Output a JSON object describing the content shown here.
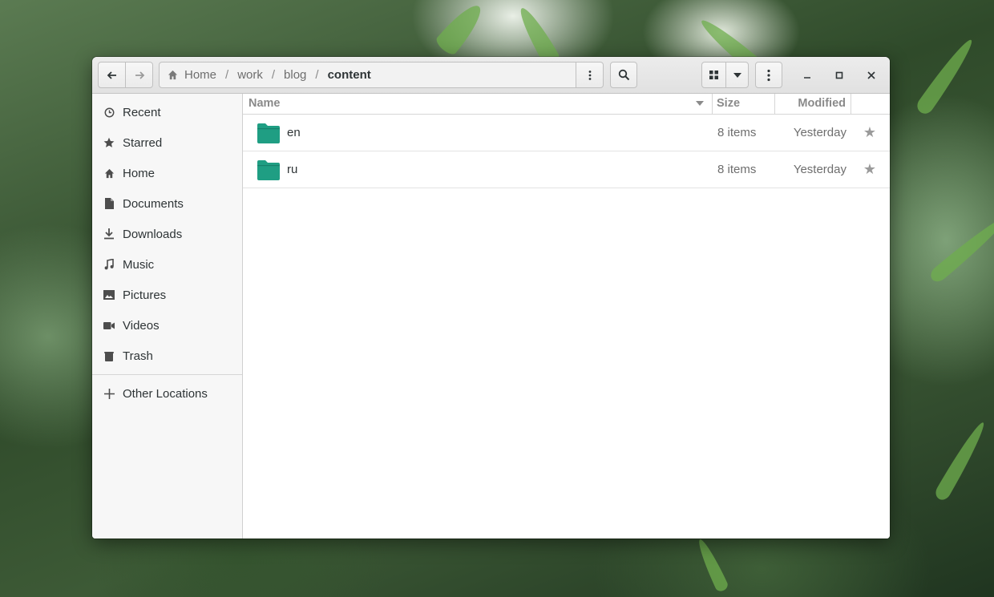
{
  "window": {
    "nav": {
      "back_icon": "arrow-left-icon",
      "forward_icon": "arrow-right-icon"
    },
    "path": [
      {
        "label": "Home",
        "icon": "home-icon"
      },
      {
        "label": "work"
      },
      {
        "label": "blog"
      },
      {
        "label": "content",
        "current": true
      }
    ],
    "path_separator": "/"
  },
  "sidebar": {
    "items": [
      {
        "label": "Recent",
        "icon": "clock-icon"
      },
      {
        "label": "Starred",
        "icon": "star-icon"
      },
      {
        "label": "Home",
        "icon": "home-icon"
      },
      {
        "label": "Documents",
        "icon": "document-icon"
      },
      {
        "label": "Downloads",
        "icon": "download-icon"
      },
      {
        "label": "Music",
        "icon": "music-note-icon"
      },
      {
        "label": "Pictures",
        "icon": "image-icon"
      },
      {
        "label": "Videos",
        "icon": "video-camera-icon"
      },
      {
        "label": "Trash",
        "icon": "trash-icon"
      }
    ],
    "other_locations": {
      "label": "Other Locations",
      "icon": "plus-icon"
    }
  },
  "columns": {
    "name": "Name",
    "size": "Size",
    "modified": "Modified"
  },
  "files": [
    {
      "name": "en",
      "size": "8 items",
      "modified": "Yesterday",
      "icon": "folder-icon"
    },
    {
      "name": "ru",
      "size": "8 items",
      "modified": "Yesterday",
      "icon": "folder-icon"
    }
  ],
  "colors": {
    "folder": "#1f9e83",
    "headerbar": "#e4e4e4",
    "sidebar": "#f7f7f7"
  }
}
